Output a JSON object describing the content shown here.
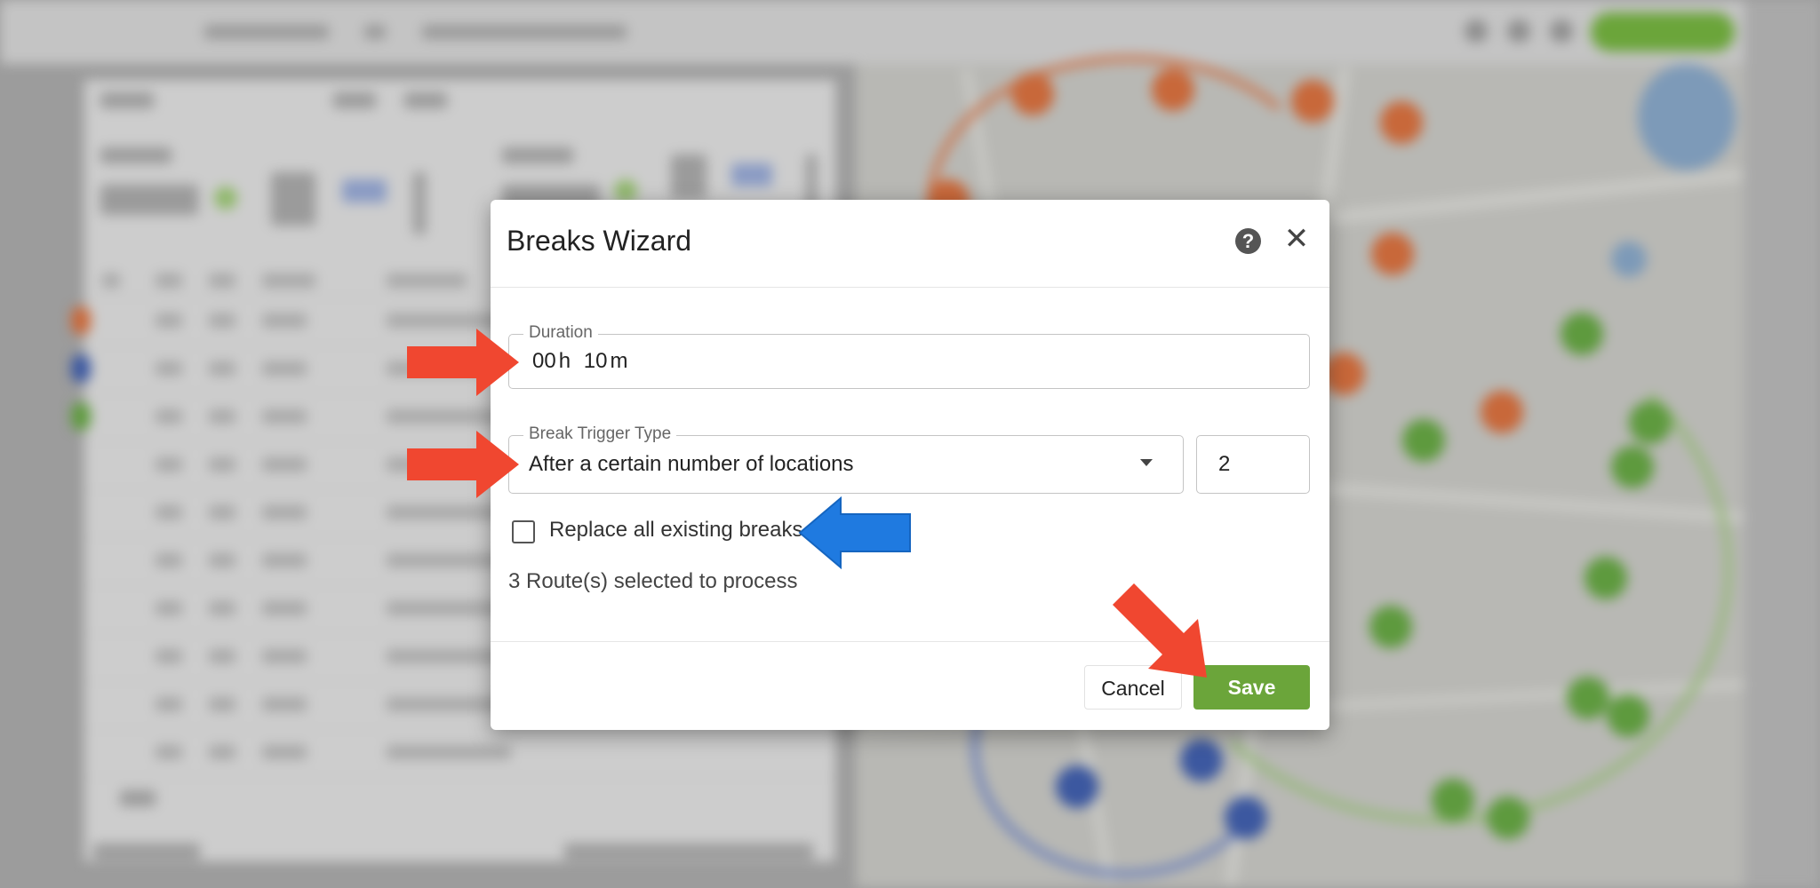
{
  "dialog": {
    "title": "Breaks Wizard",
    "duration": {
      "label": "Duration",
      "hours": "00",
      "hours_unit": "h",
      "minutes": "10",
      "minutes_unit": "m"
    },
    "trigger": {
      "label": "Break Trigger Type",
      "selected": "After a certain number of locations",
      "count": "2"
    },
    "replace_breaks": {
      "label": "Replace all existing breaks",
      "checked": false
    },
    "routes_selected": "3 Route(s) selected to process",
    "cancel_label": "Cancel",
    "save_label": "Save"
  },
  "icons": {
    "help": "help-icon",
    "close": "close-icon",
    "dropdown": "chevron-down-icon"
  },
  "colors": {
    "save_button": "#6ba53a",
    "annotation_red": "#f04730",
    "annotation_blue": "#1f7ae0"
  }
}
